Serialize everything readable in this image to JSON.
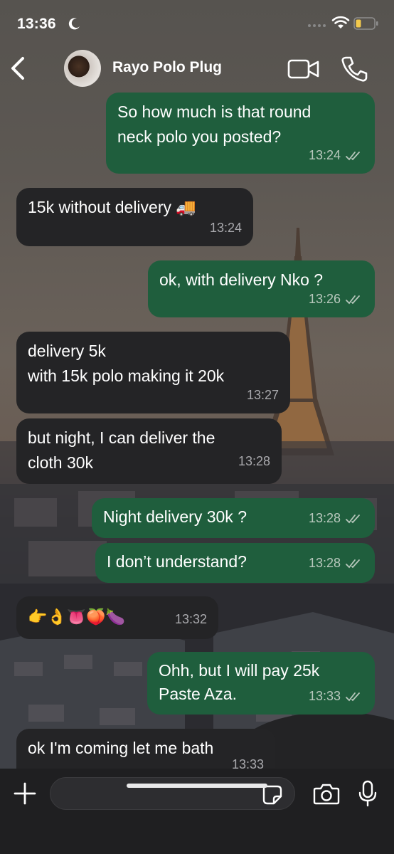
{
  "status_bar": {
    "time": "13:36"
  },
  "header": {
    "contact_name": "Rayo Polo Plug"
  },
  "messages": [
    {
      "direction": "out",
      "text": "So how much is that round\nneck polo you posted?",
      "time": "13:24",
      "read": true
    },
    {
      "direction": "in",
      "text": "15k without delivery 🚚",
      "time": "13:24"
    },
    {
      "direction": "out",
      "text": "ok, with delivery Nko ?",
      "time": "13:26",
      "read": true
    },
    {
      "direction": "in",
      "text": "delivery 5k\nwith 15k polo making it 20k",
      "time": "13:27"
    },
    {
      "direction": "in",
      "text": "but night, I can deliver the\ncloth 30k",
      "time": "13:28"
    },
    {
      "direction": "out",
      "text": "Night delivery 30k ?",
      "time": "13:28",
      "read": true
    },
    {
      "direction": "out",
      "text": "I don’t understand?",
      "time": "13:28",
      "read": true
    },
    {
      "direction": "in",
      "text": "👉👌👅🍑🍆",
      "time": "13:32"
    },
    {
      "direction": "out",
      "text": "Ohh, but I will pay 25k\nPaste Aza.",
      "time": "13:33",
      "read": true
    },
    {
      "direction": "in",
      "text": "ok I'm coming let me bath",
      "time": "13:33"
    }
  ],
  "input": {
    "value": "",
    "placeholder": ""
  },
  "colors": {
    "outgoing_bubble": "#1f5e3d",
    "incoming_bubble": "#242426",
    "read_tick": "#b8c8bd"
  },
  "icons": [
    "moon-icon",
    "signal-icon",
    "wifi-icon",
    "battery-icon",
    "back-icon",
    "video-call-icon",
    "phone-call-icon",
    "plus-icon",
    "sticker-icon",
    "camera-icon",
    "mic-icon",
    "double-check-icon",
    "delivery-truck-emoji"
  ]
}
